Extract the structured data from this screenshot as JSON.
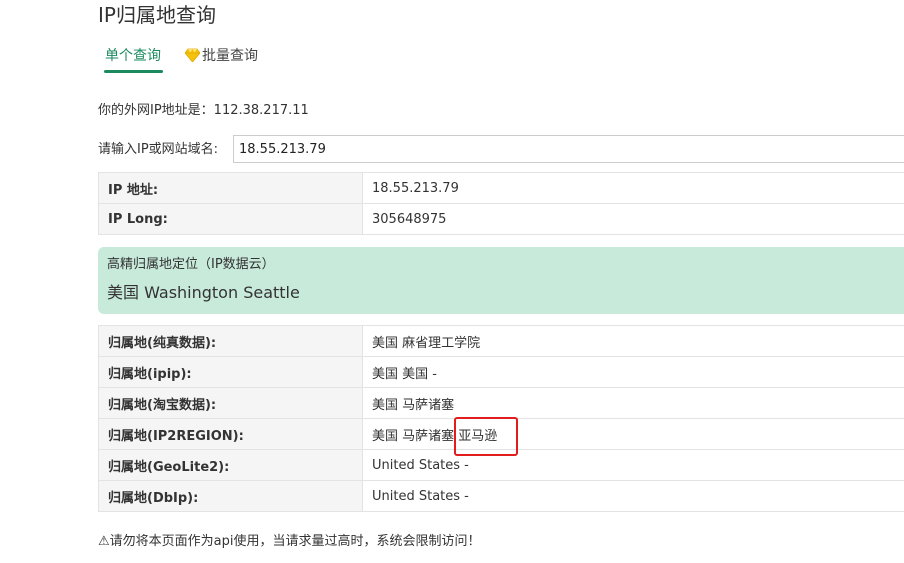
{
  "page": {
    "title": "IP归属地查询"
  },
  "tabs": [
    {
      "label": "单个查询",
      "active": true
    },
    {
      "label": "批量查询",
      "active": false,
      "icon": "diamond-icon"
    }
  ],
  "my_ip": {
    "text": "你的外网IP地址是：112.38.217.11"
  },
  "search": {
    "label": "请输入IP或网站域名:",
    "value": "18.55.213.79"
  },
  "info_rows": [
    {
      "key": "IP 地址:",
      "value": "18.55.213.79"
    },
    {
      "key": "IP Long:",
      "value": "305648975"
    }
  ],
  "geo": {
    "subtitle": "高精归属地定位（IP数据云）",
    "location": "美国 Washington Seattle"
  },
  "attribution_rows": [
    {
      "key": "归属地(纯真数据):",
      "value": "美国 麻省理工学院"
    },
    {
      "key": "归属地(ipip):",
      "value": "美国 美国 -"
    },
    {
      "key": "归属地(淘宝数据):",
      "value": "美国 马萨诸塞"
    },
    {
      "key": "归属地(IP2REGION):",
      "value": "美国 马萨诸塞 亚马逊"
    },
    {
      "key": "归属地(GeoLite2):",
      "value": "United States -"
    },
    {
      "key": "归属地(DbIp):",
      "value": "United States -"
    }
  ],
  "warning": {
    "text": "⚠请勿将本页面作为api使用，当请求量过高时，系统会限制访问！"
  },
  "colors": {
    "accent": "#1c8a5f",
    "geo_background": "#c8eadb",
    "highlight": "#e11d1d"
  }
}
